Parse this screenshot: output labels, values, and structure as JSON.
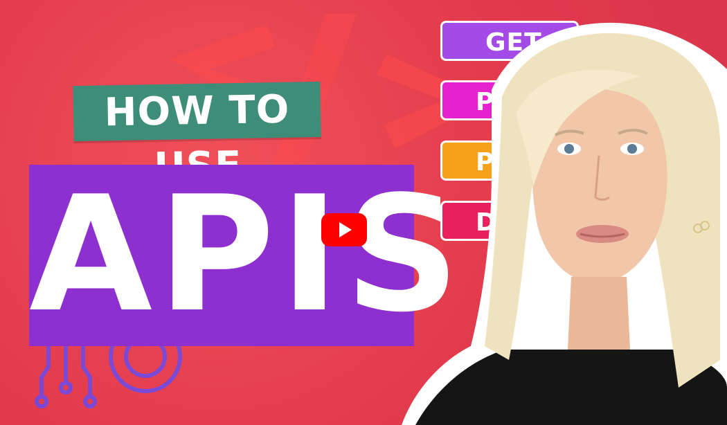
{
  "thumbnail": {
    "headline_small": "HOW TO USE",
    "headline_big": "APIS",
    "methods": [
      {
        "label": "GET"
      },
      {
        "label": "POS"
      },
      {
        "label": "PU"
      },
      {
        "label": "DE"
      }
    ]
  },
  "colors": {
    "background": "#e23a4c",
    "howto_bg": "#3e8d79",
    "apis_bg": "#8e2fcf",
    "get": "#a44ae6",
    "post": "#e622cf",
    "put": "#f7a11a",
    "delete": "#e8205c",
    "play_button": "#ff0000"
  },
  "icons": {
    "play": "youtube-play-icon",
    "code": "code-bracket-icon",
    "circuit": "circuit-gear-icon"
  }
}
